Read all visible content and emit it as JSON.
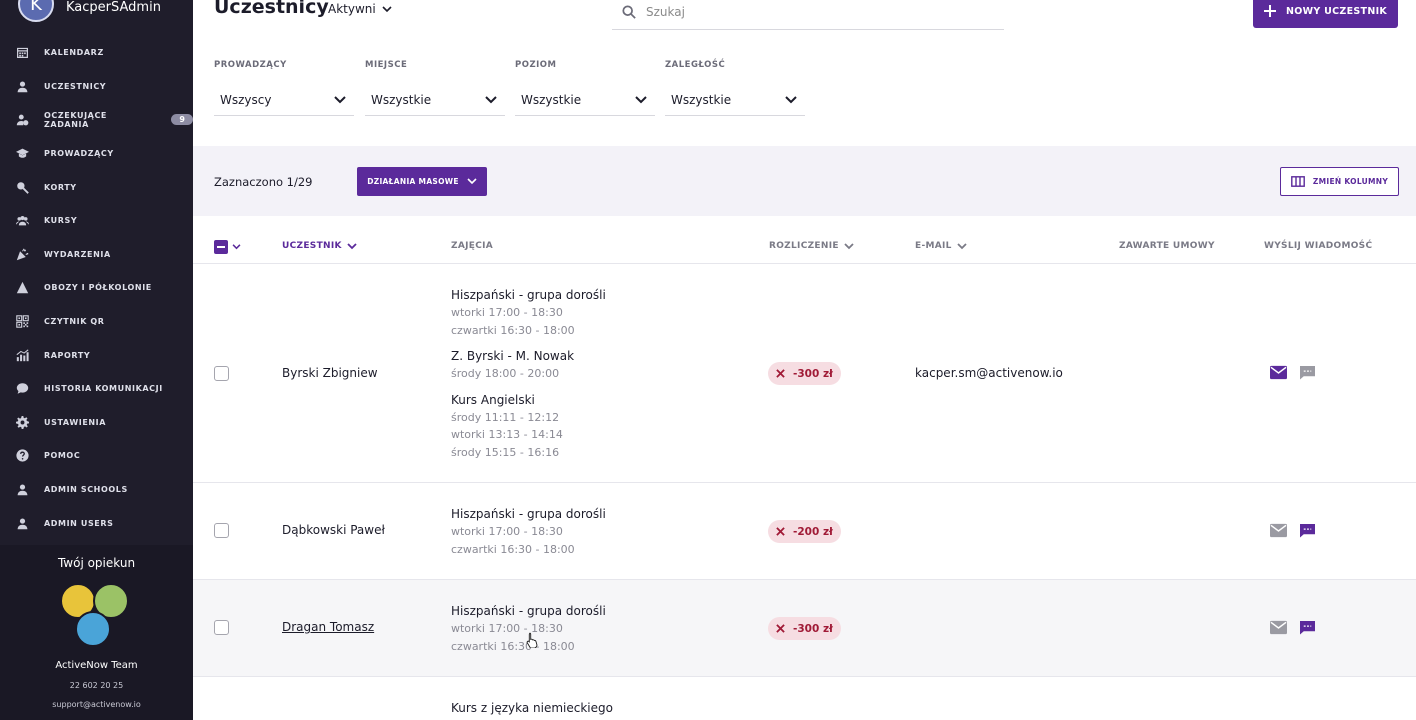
{
  "sidebar": {
    "avatar_letter": "K",
    "username": "KacperSAdmin",
    "items": [
      {
        "label": "KALENDARZ",
        "icon": "calendar-icon"
      },
      {
        "label": "UCZESTNICY",
        "icon": "user-icon"
      },
      {
        "label": "OCZEKUJĄCE ZADANIA",
        "icon": "user-clock-icon",
        "badge": "9"
      },
      {
        "label": "PROWADZĄCY",
        "icon": "graduation-cap-icon"
      },
      {
        "label": "KORTY",
        "icon": "racket-icon"
      },
      {
        "label": "KURSY",
        "icon": "users-icon"
      },
      {
        "label": "WYDARZENIA",
        "icon": "party-icon"
      },
      {
        "label": "OBOZY I PÓŁKOLONIE",
        "icon": "tent-icon"
      },
      {
        "label": "CZYTNIK QR",
        "icon": "qr-icon"
      },
      {
        "label": "RAPORTY",
        "icon": "chart-icon"
      },
      {
        "label": "HISTORIA KOMUNIKACJI",
        "icon": "chat-bubble-icon"
      },
      {
        "label": "USTAWIENIA",
        "icon": "gear-icon"
      },
      {
        "label": "POMOC",
        "icon": "help-icon"
      },
      {
        "label": "ADMIN SCHOOLS",
        "icon": "user-icon"
      },
      {
        "label": "ADMIN USERS",
        "icon": "user-icon"
      }
    ],
    "care": {
      "title": "Twój opiekun",
      "team": "ActiveNow Team",
      "phone": "22 602 20 25",
      "email": "support@activenow.io"
    }
  },
  "header": {
    "title": "Uczestnicy",
    "status": "Aktywni",
    "search_placeholder": "Szukaj",
    "new_button": "NOWY UCZESTNIK"
  },
  "filters": [
    {
      "label": "PROWADZĄCY",
      "value": "Wszyscy"
    },
    {
      "label": "MIEJSCE",
      "value": "Wszystkie"
    },
    {
      "label": "POZIOM",
      "value": "Wszystkie"
    },
    {
      "label": "ZALEGŁOŚĆ",
      "value": "Wszystkie"
    }
  ],
  "bulk": {
    "selected": "Zaznaczono 1/29",
    "mass_actions": "DZIAŁANIA MASOWE",
    "change_columns": "ZMIEŃ KOLUMNY"
  },
  "table": {
    "columns": {
      "participant": "UCZESTNIK",
      "classes": "ZAJĘCIA",
      "billing": "ROZLICZENIE",
      "email": "E-MAIL",
      "contracts": "ZAWARTE UMOWY",
      "message": "WYŚLIJ WIADOMOŚĆ"
    },
    "rows": [
      {
        "name": "Byrski Zbigniew",
        "classes": [
          {
            "title": "Hiszpański - grupa dorośli",
            "slots": [
              "wtorki 17:00 - 18:30",
              "czwartki 16:30 - 18:00"
            ]
          },
          {
            "title": "Z. Byrski - M. Nowak",
            "slots": [
              "środy 18:00 - 20:00"
            ]
          },
          {
            "title": "Kurs Angielski",
            "slots": [
              "środy 11:11 - 12:12",
              "wtorki 13:13 - 14:14",
              "środy 15:15 - 16:16"
            ]
          }
        ],
        "debt": "-300 zł",
        "email": "kacper.sm@activenow.io"
      },
      {
        "name": "Dąbkowski Paweł",
        "classes": [
          {
            "title": "Hiszpański - grupa dorośli",
            "slots": [
              "wtorki 17:00 - 18:30",
              "czwartki 16:30 - 18:00"
            ]
          }
        ],
        "debt": "-200 zł",
        "email": ""
      },
      {
        "name": "Dragan Tomasz",
        "classes": [
          {
            "title": "Hiszpański - grupa dorośli",
            "slots": [
              "wtorki 17:00 - 18:30",
              "czwartki 16:30 - 18:00"
            ]
          }
        ],
        "debt": "-300 zł",
        "email": ""
      },
      {
        "name": "",
        "classes": [
          {
            "title": "Kurs z języka niemieckiego",
            "slots": []
          }
        ],
        "debt": "",
        "email": ""
      }
    ]
  },
  "colors": {
    "sidebar_bg": "#1f1d2b",
    "accent": "#5b2a9b",
    "debt_bg": "#f6dde2",
    "debt_text": "#a01a36"
  }
}
